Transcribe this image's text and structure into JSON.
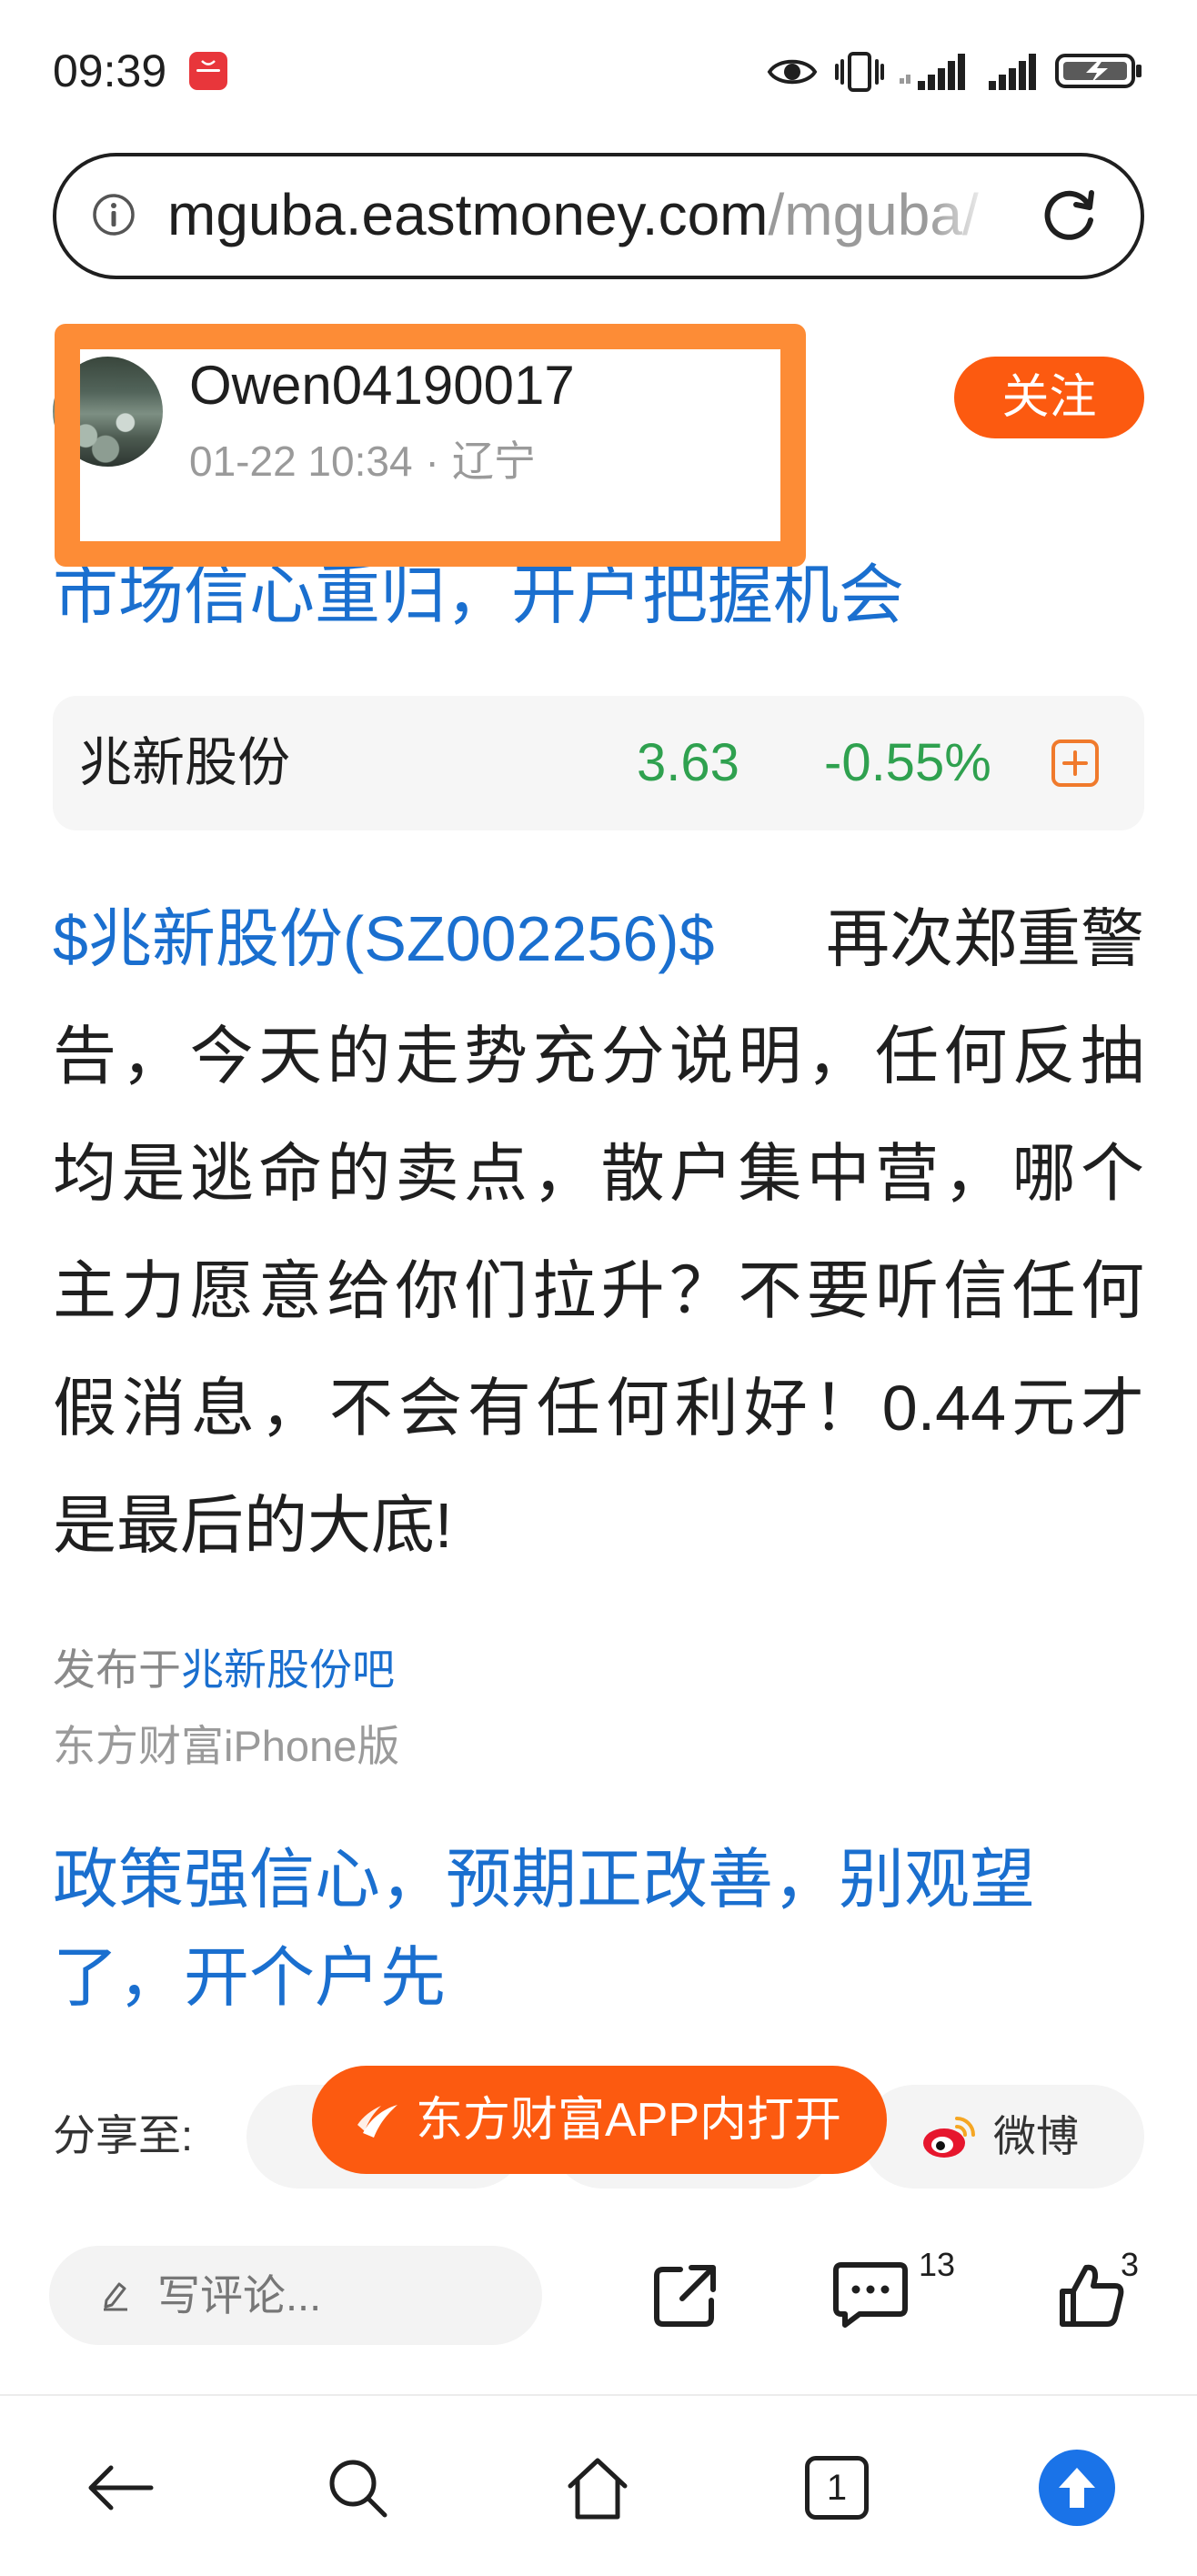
{
  "colors": {
    "link_blue": "#1a6fcf",
    "brand_orange": "#fc5a10",
    "highlight_frame_orange": "#fd8c36",
    "price_green": "#2fa14f",
    "nav_blue": "#1a73e8"
  },
  "status_bar": {
    "time": "09:39",
    "icons": [
      "huawei-appgallery-icon",
      "eye-icon",
      "vibrate-icon",
      "signal-icon",
      "signal-icon",
      "battery-charging-icon"
    ]
  },
  "address_bar": {
    "domain": "mguba.eastmoney.com",
    "path": "/mguba/",
    "icons": [
      "info-icon",
      "refresh-icon"
    ]
  },
  "author": {
    "name": "Owen04190017",
    "time": "01-22 10:34",
    "separator": "·",
    "location": "辽宁",
    "follow_label": "关注"
  },
  "headline_top": "市场信心重归，开户把握机会",
  "stock_card": {
    "name": "兆新股份",
    "price": "3.63",
    "change": "-0.55%",
    "icon": "add-to-watchlist-icon"
  },
  "post": {
    "mention": "$兆新股份(SZ002256)$",
    "body_lines": [
      "再次郑重警",
      "告，今天的走势充分说明，任何反抽",
      "均是逃命的卖点，散户集中营，哪个",
      "主力愿意给你们拉升？不要听信任何",
      "假消息，不会有任何利好！0.44元才",
      "是最后的大底!"
    ],
    "published_prefix": "发布于",
    "forum": "兆新股份吧",
    "source": "东方财富iPhone版"
  },
  "headline_bottom": {
    "lines": [
      "政策强信心，预期正改善，别观望",
      "了，开个户先"
    ]
  },
  "share": {
    "label": "分享至:",
    "weibo_label": "微博",
    "open_in_app_label": "东方财富APP内打开"
  },
  "action_bar": {
    "comment_placeholder": "写评论...",
    "comment_count": "13",
    "like_count": "3",
    "icons": [
      "pencil-icon",
      "share-external-icon",
      "comment-icon",
      "thumbs-up-icon"
    ]
  },
  "bottom_nav": {
    "tab_count": "1",
    "icons": [
      "back-arrow-icon",
      "search-icon",
      "home-icon",
      "tabs-icon",
      "scroll-to-top-icon"
    ]
  }
}
